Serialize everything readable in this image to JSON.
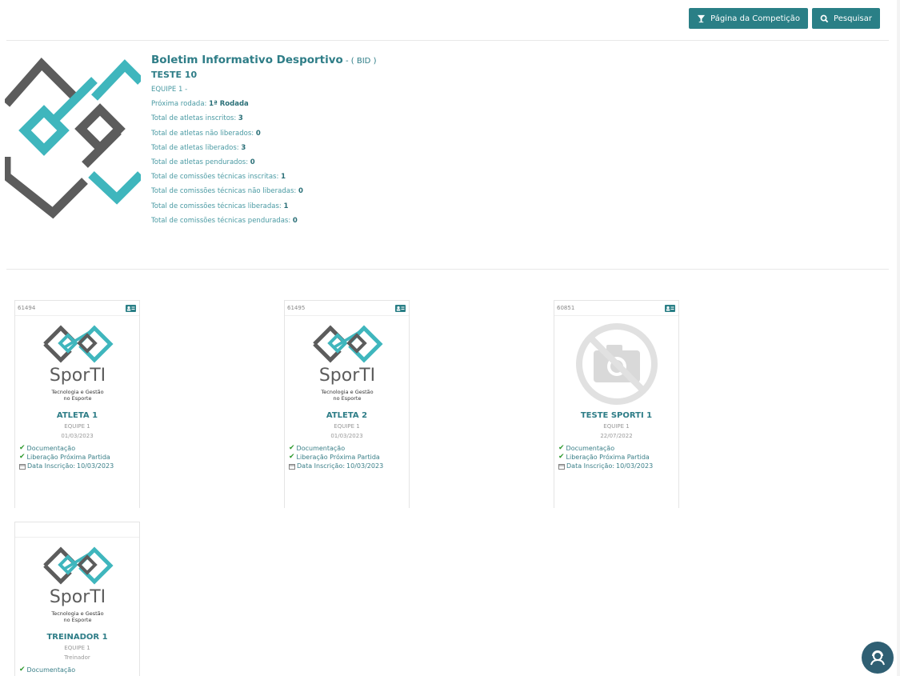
{
  "toolbar": {
    "competition_label": "Página da Competição",
    "search_label": "Pesquisar"
  },
  "header": {
    "title": "Boletim Informativo Desportivo",
    "title_suffix": " - ( BID )",
    "competition": "TESTE 10",
    "team": "EQUIPE 1 -",
    "stats": [
      {
        "label": "Próxima rodada: ",
        "value": "1ª Rodada"
      },
      {
        "label": "Total de atletas inscritos: ",
        "value": "3"
      },
      {
        "label": "Total de atletas não liberados: ",
        "value": "0"
      },
      {
        "label": "Total de atletas liberados: ",
        "value": "3"
      },
      {
        "label": "Total de atletas pendurados: ",
        "value": "0"
      },
      {
        "label": "Total de comissões técnicas inscritas: ",
        "value": "1"
      },
      {
        "label": "Total de comissões técnicas não liberadas: ",
        "value": "0"
      },
      {
        "label": "Total de comissões técnicas liberadas: ",
        "value": "1"
      },
      {
        "label": "Total de comissões técnicas penduradas: ",
        "value": "0"
      }
    ]
  },
  "logo_text": {
    "brand": "SporTI",
    "tagline_1": "Tecnologia e Gestão",
    "tagline_2": "no Esporte"
  },
  "checks": {
    "documentation": "Documentação",
    "release": "Liberação Próxima Partida",
    "registration_prefix": "Data Inscrição: "
  },
  "cards": [
    {
      "id": "61494",
      "name": "ATLETA 1",
      "team": "EQUIPE 1",
      "date": "01/03/2023",
      "registration": "10/03/2023"
    },
    {
      "id": "61495",
      "name": "ATLETA 2",
      "team": "EQUIPE 1",
      "date": "01/03/2023",
      "registration": "10/03/2023"
    },
    {
      "id": "60851",
      "name": "TESTE SPORTI 1",
      "team": "EQUIPE 1",
      "date": "22/07/2022",
      "registration": "10/03/2023"
    },
    {
      "id": "",
      "name": "TREINADOR 1",
      "team": "EQUIPE 1",
      "role": "Treinador"
    }
  ],
  "colors": {
    "primary": "#2a7f86",
    "teal_logo": "#3fb6bd",
    "gray_logo": "#5c5c5c",
    "check_green": "#2e9a2e",
    "help_bubble": "#2f5f73"
  }
}
